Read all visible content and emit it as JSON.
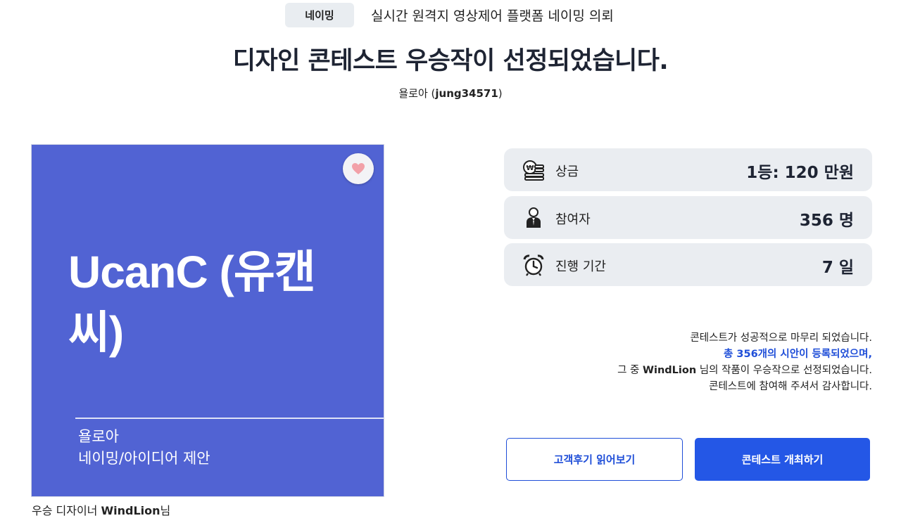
{
  "header": {
    "category": "네이밍",
    "contest_title": "실시간 원격지 영상제어 플랫폼 네이밍 의뢰",
    "headline": "디자인 콘테스트 우승작이 선정되었습니다.",
    "client_name": "욜로아",
    "client_id": "jung34571"
  },
  "card": {
    "name": "UcanC (유캔씨)",
    "author": "욜로아",
    "type": "네이밍/아이디어 제안",
    "bg_color": "#5163d3"
  },
  "winner": {
    "prefix": "우승 디자이너",
    "name": "WindLion",
    "suffix": "님"
  },
  "stats": [
    {
      "icon": "prize-coins-icon",
      "label": "상금",
      "value": "1등: 120 만원"
    },
    {
      "icon": "participant-person-icon",
      "label": "참여자",
      "value": "356 명"
    },
    {
      "icon": "alarm-clock-icon",
      "label": "진행 기간",
      "value": "7 일"
    }
  ],
  "summary": {
    "line1": "콘테스트가 성공적으로 마무리 되었습니다.",
    "line2": "총 356개의 시안이 등록되었으며,",
    "line3_prefix": "그 중",
    "line3_name": "WindLion",
    "line3_suffix": "님의 작품이 우승작으로 선정되었습니다.",
    "line4": "콘테스트에 참여해 주셔서 감사합니다."
  },
  "buttons": {
    "reviews": "고객후기 읽어보기",
    "host": "콘테스트 개최하기"
  },
  "colors": {
    "accent": "#2457e6",
    "highlight_text": "#1f4ed8",
    "stat_bg": "#eaedf1",
    "heart": "#f2a0a8"
  }
}
